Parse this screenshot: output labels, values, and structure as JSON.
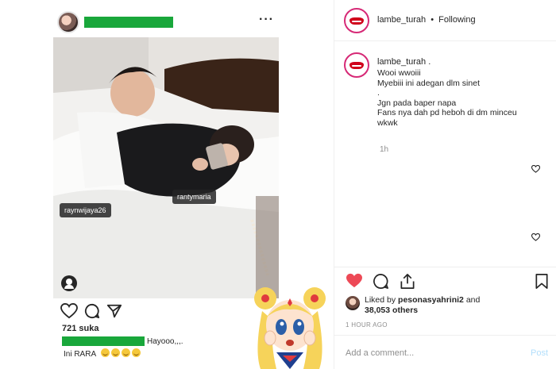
{
  "left_post": {
    "more_label": "···",
    "tags": [
      "raynwijaya26",
      "rantymaria"
    ],
    "likes": "721 suka",
    "caption_text": "Hayooo,,,.",
    "comment2": "Ini RARA"
  },
  "panel": {
    "header": {
      "username": "lambe_turah",
      "separator": "•",
      "follow_state": "Following",
      "more_label": "···"
    },
    "caption": {
      "username": "lambe_turah .",
      "lines": [
        "Wooi wwoiii",
        "Myebiii ini adegan dlm sinet",
        ".",
        "Jgn pada baper napa",
        "Fans nya dah pd heboh di dm minceu",
        "wkwk"
      ],
      "time": "1h"
    },
    "liked_by": {
      "prefix": "Liked by ",
      "user": "pesonasyahrini2",
      "and": " and",
      "others": "38,053 others"
    },
    "time_ago": "1 HOUR AGO",
    "comment_placeholder": "Add a comment...",
    "post_button": "Post"
  },
  "colors": {
    "redaction": "#19a73b",
    "like_red": "#ed4956",
    "lips_red": "#d0021b",
    "post_btn": "#b2dffc"
  }
}
